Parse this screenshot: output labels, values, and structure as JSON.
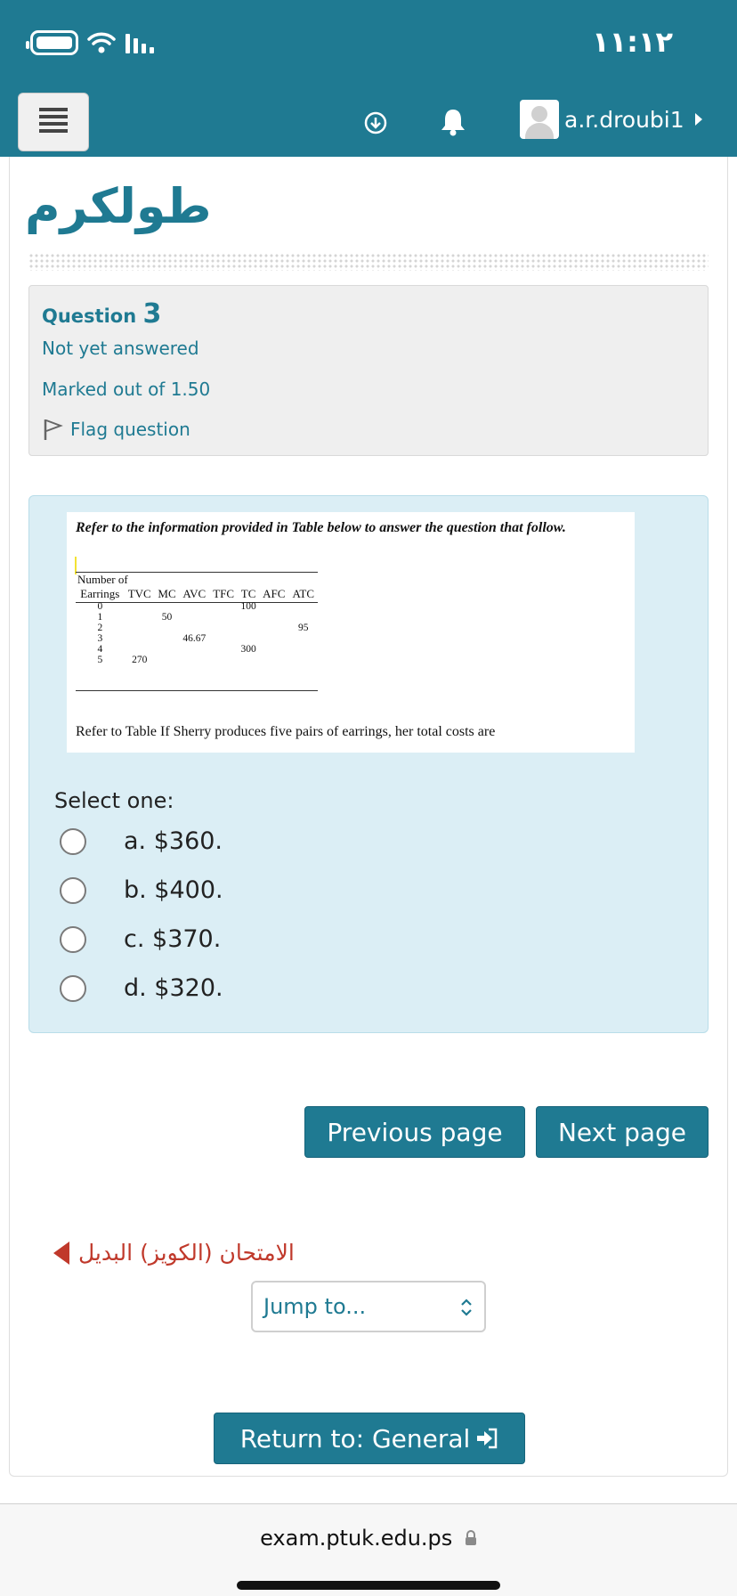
{
  "status": {
    "time": "١١:١٢"
  },
  "header": {
    "username": "a.r.droubi1"
  },
  "course": {
    "title": "طولكرم"
  },
  "question_info": {
    "label": "Question",
    "number": "3",
    "state": "Not yet answered",
    "mark": "Marked out of 1.50",
    "flag": "Flag question"
  },
  "question": {
    "intro": "Refer to the information provided in Table below to answer the question that follow.",
    "table_header": {
      "c1_line1": "Number of",
      "c1_line2": "Earrings",
      "cols": [
        "TVC",
        "MC",
        "AVC",
        "TFC",
        "TC",
        "AFC",
        "ATC"
      ]
    },
    "rows": [
      {
        "n": "0",
        "tvc": "",
        "mc": "",
        "avc": "",
        "tfc": "",
        "tc": "100",
        "afc": "",
        "atc": ""
      },
      {
        "n": "1",
        "tvc": "",
        "mc": "50",
        "avc": "",
        "tfc": "",
        "tc": "",
        "afc": "",
        "atc": ""
      },
      {
        "n": "2",
        "tvc": "",
        "mc": "",
        "avc": "",
        "tfc": "",
        "tc": "",
        "afc": "",
        "atc": "95"
      },
      {
        "n": "3",
        "tvc": "",
        "mc": "",
        "avc": "46.67",
        "tfc": "",
        "tc": "",
        "afc": "",
        "atc": ""
      },
      {
        "n": "4",
        "tvc": "",
        "mc": "",
        "avc": "",
        "tfc": "",
        "tc": "300",
        "afc": "",
        "atc": ""
      },
      {
        "n": "5",
        "tvc": "270",
        "mc": "",
        "avc": "",
        "tfc": "",
        "tc": "",
        "afc": "",
        "atc": ""
      }
    ],
    "text": "Refer to Table If Sherry produces five pairs of earrings, her total costs are",
    "select_label": "Select one:",
    "options": [
      "a. $360.",
      "b. $400.",
      "c. $370.",
      "d. $320."
    ]
  },
  "nav": {
    "previous": "Previous page",
    "next": "Next page",
    "prev_activity": "الامتحان (الكويز) البديل",
    "jump": "Jump to...",
    "return": "Return to: General"
  },
  "browser": {
    "url": "exam.ptuk.edu.ps"
  }
}
